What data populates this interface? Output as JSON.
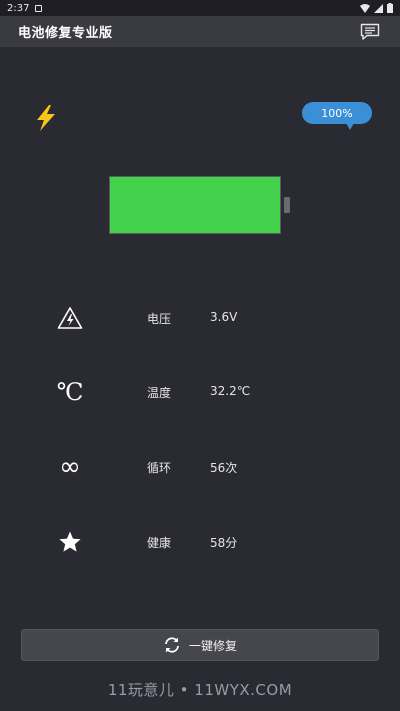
{
  "status_bar": {
    "time": "2:37"
  },
  "app_bar": {
    "title": "电池修复专业版",
    "feedback_icon": "message-icon"
  },
  "battery": {
    "percent_label": "100%",
    "level": 1.0,
    "fill_color": "#44d24c",
    "charging_icon": "lightning-bolt-icon"
  },
  "stats": [
    {
      "icon": "voltage-warning-icon",
      "label": "电压",
      "value": "3.6V"
    },
    {
      "icon": "celsius-icon",
      "icon_text": "℃",
      "label": "温度",
      "value": "32.2℃"
    },
    {
      "icon": "infinity-icon",
      "icon_text": "∞",
      "label": "循环",
      "value": "56次"
    },
    {
      "icon": "star-icon",
      "label": "健康",
      "value": "58分"
    }
  ],
  "action": {
    "label": "一键修复",
    "icon": "refresh-icon"
  },
  "watermark": "11玩意儿 • 11WYX.COM",
  "colors": {
    "background": "#2a2a32",
    "accent_blue": "#3a8fd6",
    "battery_green": "#44d24c",
    "bolt_yellow": "#f5c518"
  }
}
